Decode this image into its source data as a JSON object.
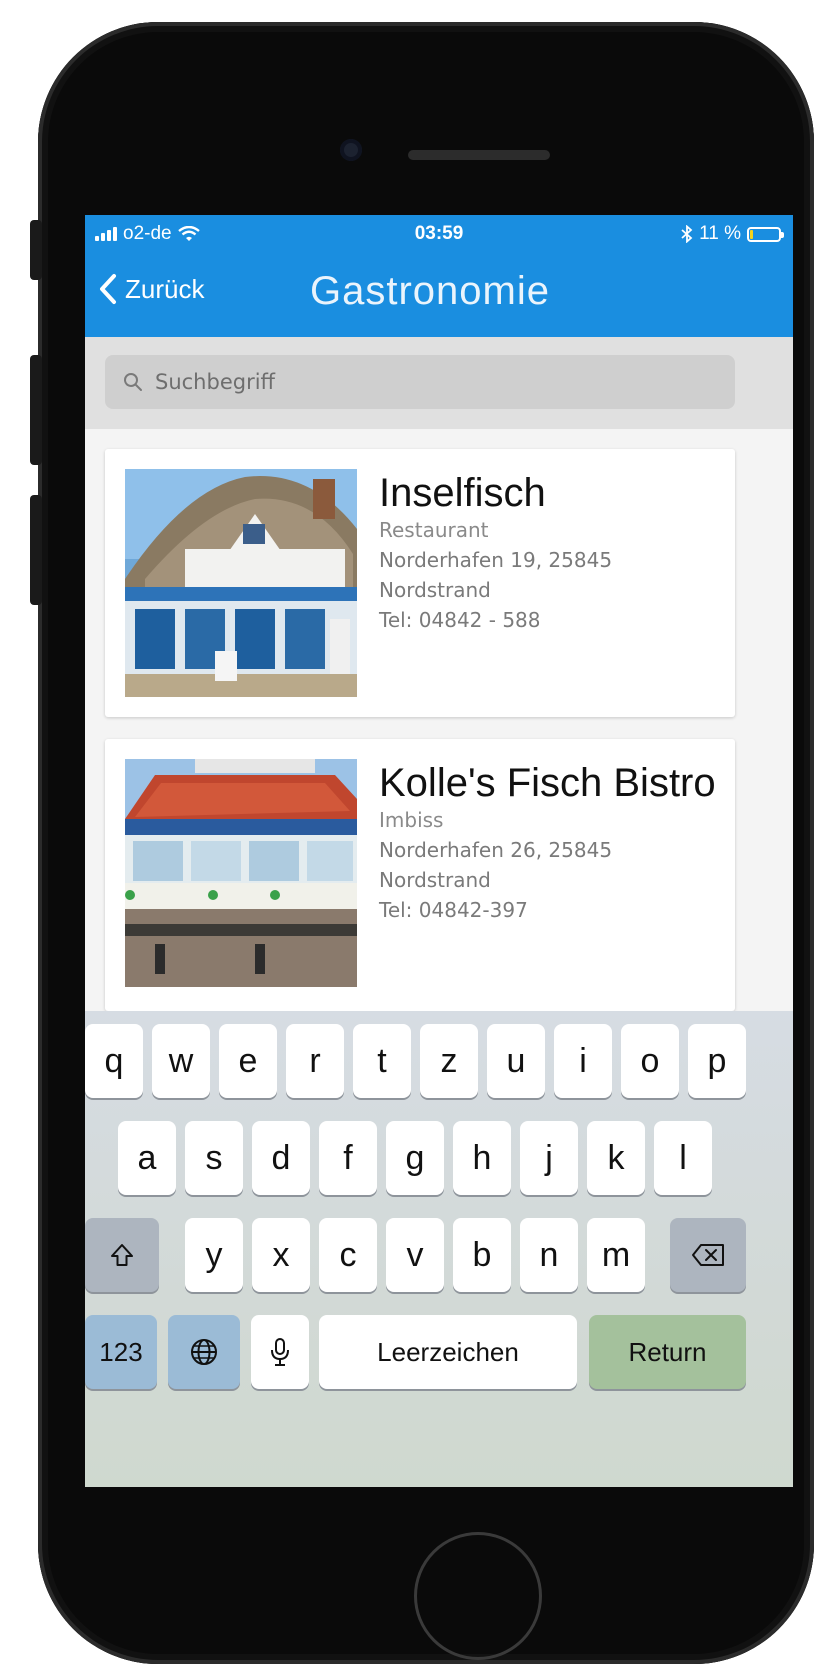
{
  "status_bar": {
    "carrier": "o2-de",
    "time": "03:59",
    "battery": "11 %",
    "battery_level": 0.11,
    "icons": [
      "signal-icon",
      "wifi-icon",
      "bluetooth-icon",
      "battery-icon"
    ]
  },
  "nav": {
    "back_label": "Zurück",
    "title": "Gastronomie"
  },
  "search": {
    "placeholder": "Suchbegriff"
  },
  "entries": [
    {
      "name": "Inselfisch",
      "category": "Restaurant",
      "address_line1": "Norderhafen 19, 25845",
      "address_line2": "Nordstrand",
      "phone": "Tel: 04842 - 588"
    },
    {
      "name": "Kolle's Fisch Bistro",
      "category": "Imbiss",
      "address_line1": "Norderhafen 26, 25845",
      "address_line2": "Nordstrand",
      "phone": "Tel: 04842-397"
    }
  ],
  "keyboard": {
    "row1": [
      "q",
      "w",
      "e",
      "r",
      "t",
      "z",
      "u",
      "i",
      "o",
      "p"
    ],
    "row2": [
      "a",
      "s",
      "d",
      "f",
      "g",
      "h",
      "j",
      "k",
      "l"
    ],
    "row3": [
      "y",
      "x",
      "c",
      "v",
      "b",
      "n",
      "m"
    ],
    "numbers_label": "123",
    "space_label": "Leerzeichen",
    "return_label": "Return"
  },
  "colors": {
    "accent": "#1a8ee0",
    "battery": "#f5d31b"
  }
}
